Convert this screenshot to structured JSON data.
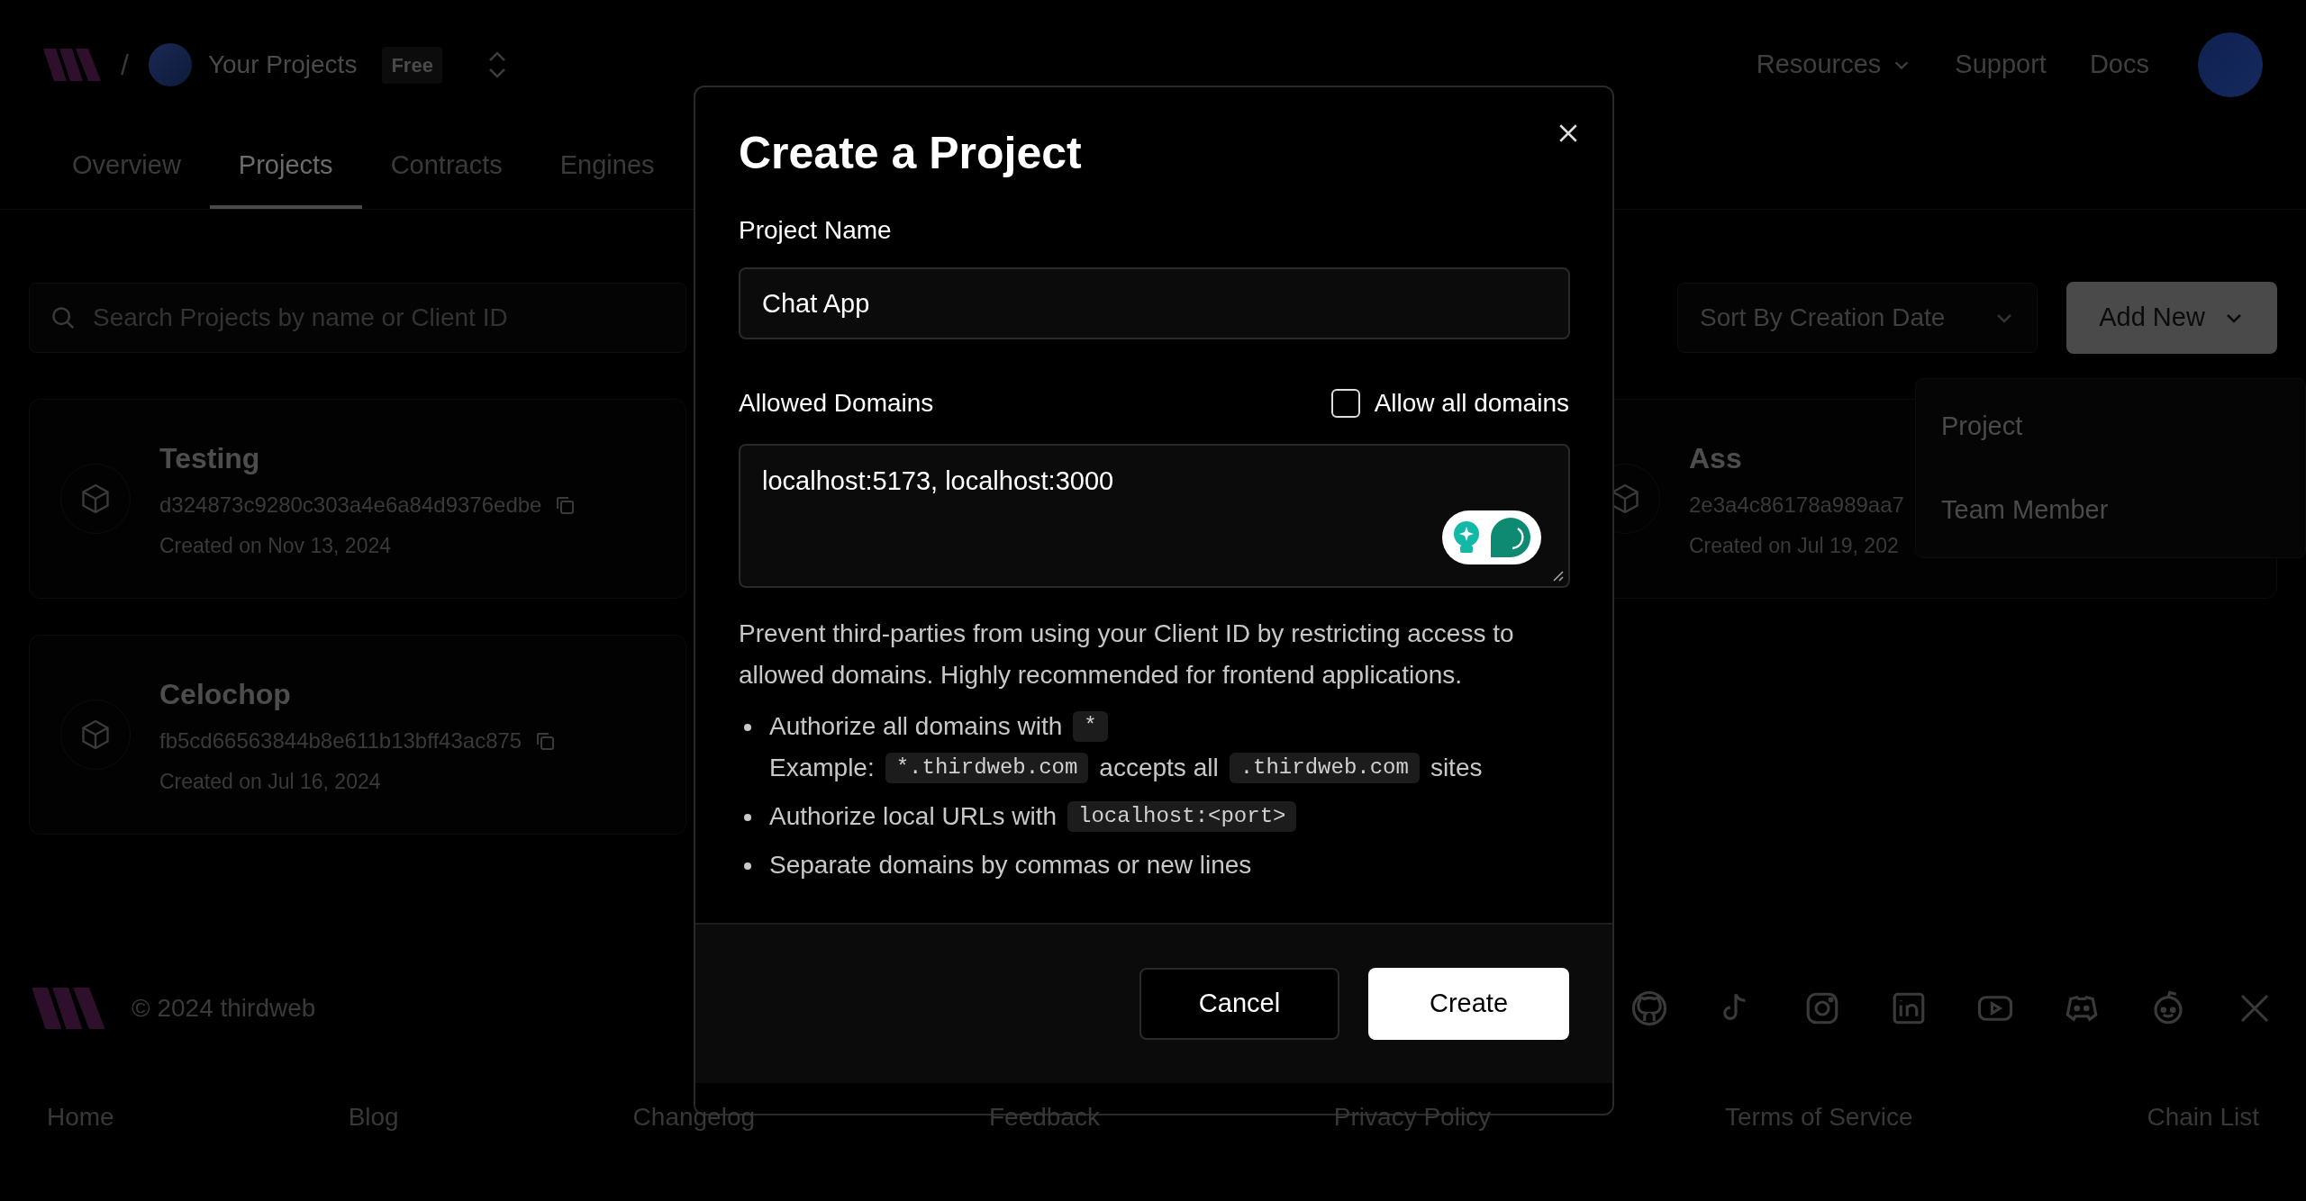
{
  "header": {
    "separator": "/",
    "workspace": "Your Projects",
    "plan_badge": "Free",
    "links": [
      {
        "label": "Resources",
        "kind": "menu"
      },
      {
        "label": "Support",
        "kind": "link"
      },
      {
        "label": "Docs",
        "kind": "link"
      }
    ]
  },
  "tabs": [
    {
      "label": "Overview",
      "selected": false
    },
    {
      "label": "Projects",
      "selected": true
    },
    {
      "label": "Contracts",
      "selected": false
    },
    {
      "label": "Engines",
      "selected": false
    }
  ],
  "toolbar": {
    "search_placeholder": "Search Projects by name or Client ID",
    "sort": "Sort By Creation Date",
    "add_button": "Add New"
  },
  "add_menu": [
    "Project",
    "Team Member"
  ],
  "left_column": [
    {
      "name": "Testing",
      "client_id": "d324873c9280c303a4e6a84d9376edbe",
      "created": "Created on Nov 13, 2024"
    },
    {
      "name": "Celochop",
      "client_id": "fb5cd66563844b8e611b13bff43ac875",
      "created": "Created on Jul 16, 2024"
    }
  ],
  "right_column": [
    {
      "name": "Ass",
      "client_id": "2e3a4c86178a989aa7",
      "created": "Created on Jul 19, 202"
    }
  ],
  "modal": {
    "title": "Create a Project",
    "project_name_label": "Project Name",
    "project_name_value": "Chat App",
    "domains_label": "Allowed Domains",
    "allow_all_label": "Allow all domains",
    "allow_all_domains": false,
    "domains_value": "localhost:5173, localhost:3000",
    "help_text": "Prevent third-parties from using your Client ID by restricting access to allowed domains. Highly recommended for frontend applications.",
    "bullets": [
      {
        "lines": [
          [
            {
              "kind": "text",
              "text": "Authorize all domains with"
            },
            {
              "kind": "code",
              "text": "*"
            }
          ],
          [
            {
              "kind": "text",
              "text": "Example:"
            },
            {
              "kind": "code",
              "text": "*.thirdweb.com"
            },
            {
              "kind": "text",
              "text": "accepts all"
            },
            {
              "kind": "code",
              "text": ".thirdweb.com"
            },
            {
              "kind": "text",
              "text": "sites"
            }
          ]
        ]
      },
      {
        "lines": [
          [
            {
              "kind": "text",
              "text": "Authorize local URLs with"
            },
            {
              "kind": "code",
              "text": "localhost:<port>"
            }
          ]
        ]
      },
      {
        "lines": [
          [
            {
              "kind": "text",
              "text": "Separate domains by commas or new lines"
            }
          ]
        ]
      }
    ],
    "cancel": "Cancel",
    "create": "Create"
  },
  "footer": {
    "copyright": "© 2024 thirdweb",
    "links": [
      "Home",
      "Blog",
      "Changelog",
      "Feedback",
      "Privacy Policy",
      "Terms of Service",
      "Chain List"
    ]
  }
}
